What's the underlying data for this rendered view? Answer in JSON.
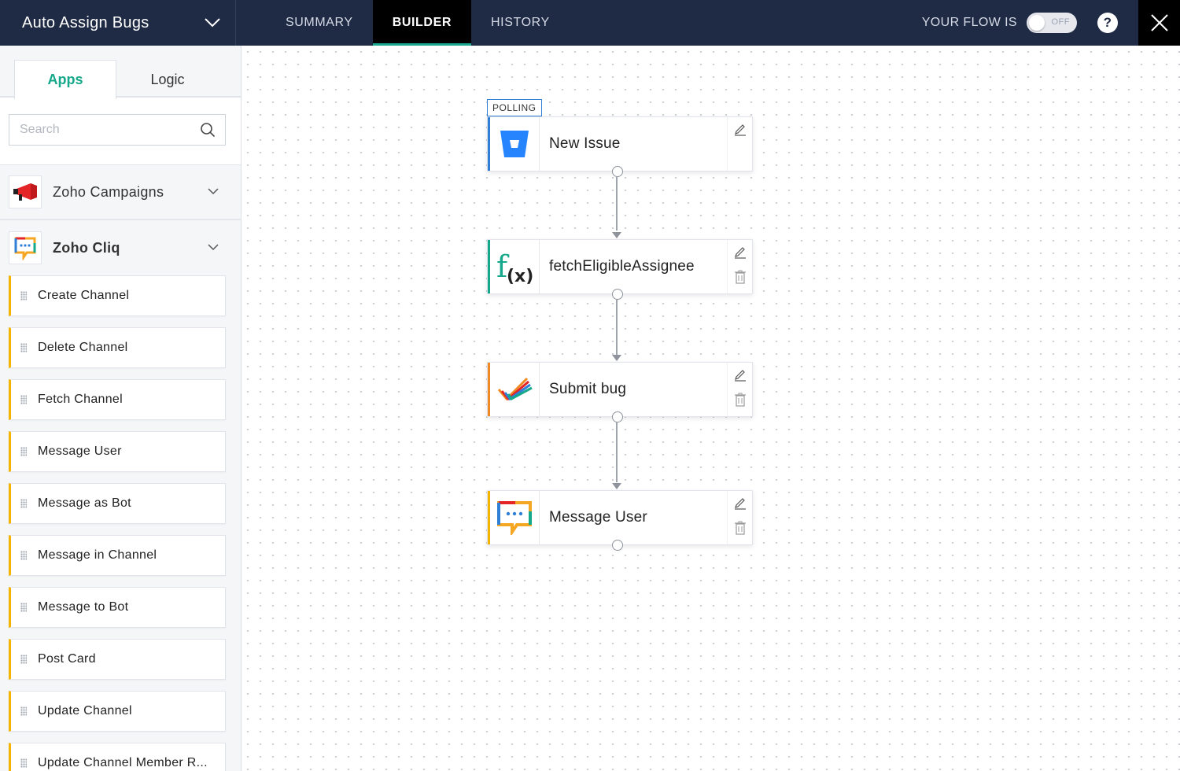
{
  "header": {
    "flow_title": "Auto Assign Bugs",
    "tabs": [
      {
        "label": "SUMMARY"
      },
      {
        "label": "BUILDER"
      },
      {
        "label": "HISTORY"
      }
    ],
    "status_label": "YOUR FLOW IS",
    "toggle_text": "OFF",
    "help_label": "?"
  },
  "sidebar": {
    "tabs": [
      {
        "label": "Apps"
      },
      {
        "label": "Logic"
      }
    ],
    "search": {
      "placeholder": "Search",
      "value": ""
    },
    "apps": [
      {
        "name": "Zoho Campaigns"
      },
      {
        "name": "Zoho Cliq"
      }
    ],
    "actions": [
      {
        "label": "Create Channel"
      },
      {
        "label": "Delete Channel"
      },
      {
        "label": "Fetch Channel"
      },
      {
        "label": "Message User"
      },
      {
        "label": "Message as Bot"
      },
      {
        "label": "Message in Channel"
      },
      {
        "label": "Message to Bot"
      },
      {
        "label": "Post Card"
      },
      {
        "label": "Update Channel"
      },
      {
        "label": "Update Channel Member R..."
      }
    ]
  },
  "canvas": {
    "trigger_badge": "POLLING",
    "nodes": [
      {
        "label": "New Issue",
        "icon": "bitbucket-icon",
        "accent": "#2f7fd6"
      },
      {
        "label": "fetchEligibleAssignee",
        "icon": "function-icon",
        "accent": "#16a88a"
      },
      {
        "label": "Submit bug",
        "icon": "zoho-bugtracker-icon",
        "accent": "#f08a24"
      },
      {
        "label": "Message User",
        "icon": "zoho-cliq-icon",
        "accent": "#f5b400"
      }
    ]
  },
  "colors": {
    "header_bg": "#1f2a44",
    "active_tab_bg": "#000000",
    "accent_green": "#16a88a",
    "action_border": "#f5b400"
  }
}
